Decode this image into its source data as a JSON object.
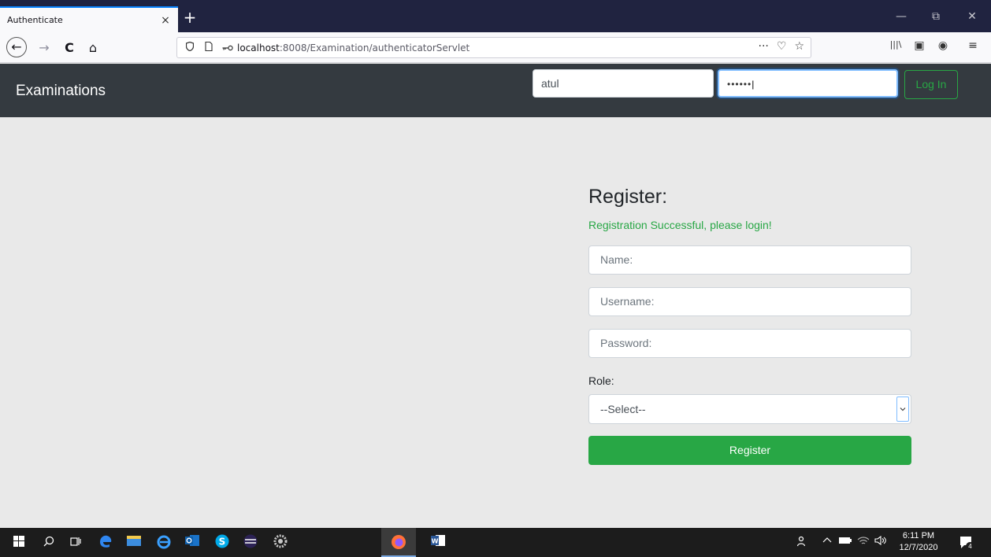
{
  "browser": {
    "tab_title": "Authenticate",
    "tab_close": "×",
    "new_tab": "+",
    "window_controls": {
      "minimize": "—",
      "restore": "⧉",
      "close": "✕"
    },
    "nav": {
      "back": "←",
      "forward": "→",
      "reload": "C",
      "home": "⌂"
    },
    "url_host": "localhost",
    "url_path": ":8008/Examination/authenticatorServlet",
    "url_actions": {
      "more": "···",
      "pocket": "♡",
      "bookmark": "☆"
    },
    "toolbar": {
      "library": "|||\\",
      "sidebar": "▣",
      "account": "◉",
      "menu": "≡"
    }
  },
  "header": {
    "brand": "Examinations",
    "username_value": "atul",
    "password_value": "••••••",
    "login_label": "Log In"
  },
  "register": {
    "title": "Register:",
    "success_message": "Registration Successful, please login!",
    "name_placeholder": "Name:",
    "username_placeholder": "Username:",
    "password_placeholder": "Password:",
    "role_label": "Role:",
    "role_selected": "--Select--",
    "submit_label": "Register"
  },
  "taskbar": {
    "time": "6:11 PM",
    "date": "12/7/2020",
    "notification_count": "4"
  },
  "colors": {
    "header_bg": "#343a40",
    "success_green": "#28a745",
    "page_bg": "#e9e9e9",
    "tabstrip_bg": "#202340"
  }
}
